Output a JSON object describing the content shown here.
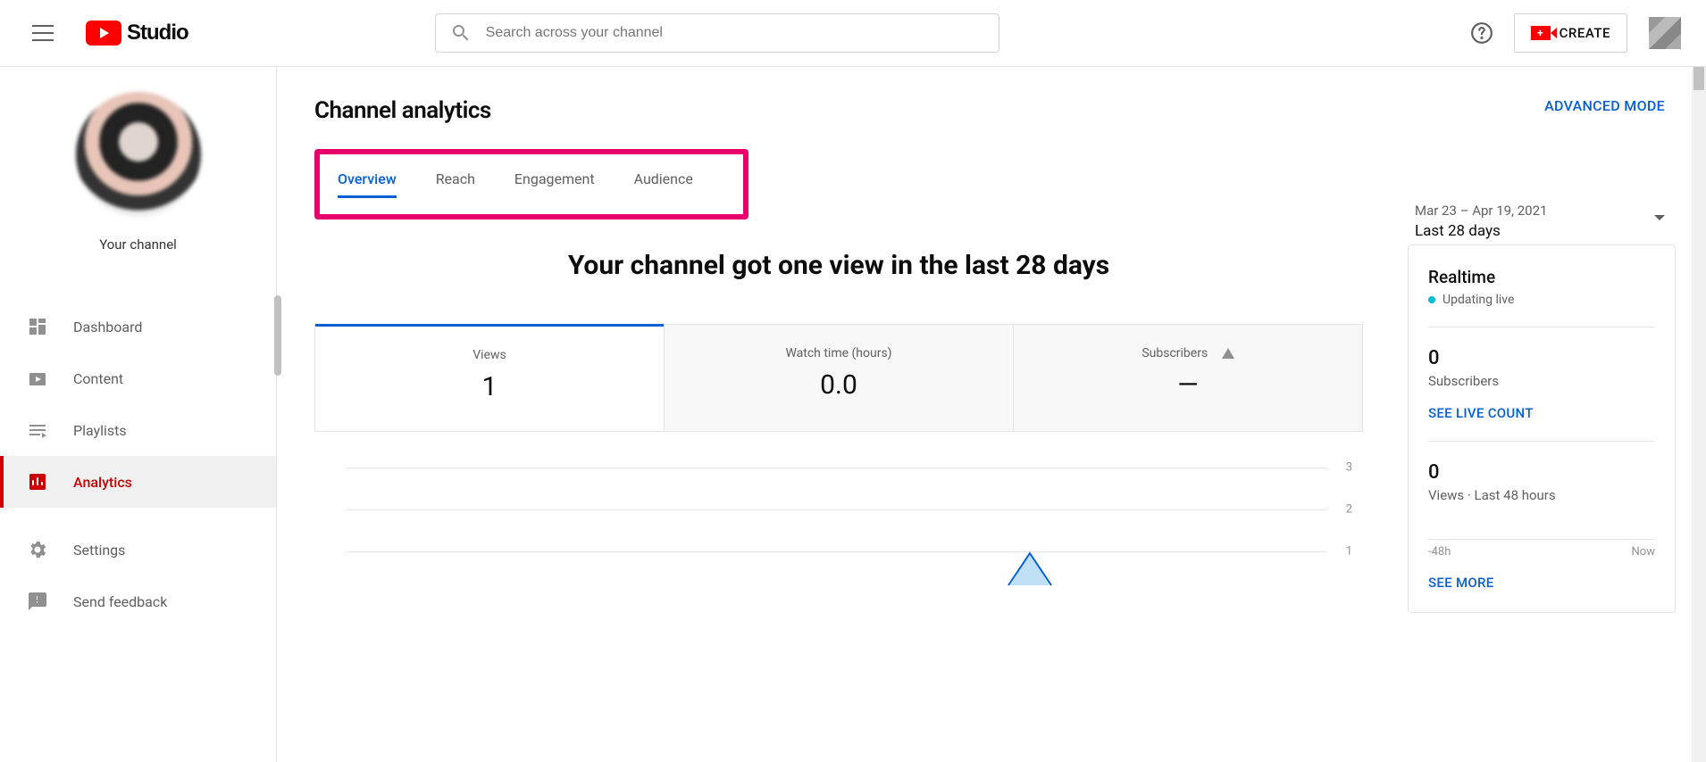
{
  "header": {
    "studio_label": "Studio",
    "search_placeholder": "Search across your channel",
    "create_label": "CREATE"
  },
  "sidebar": {
    "channel_label": "Your channel",
    "items": [
      {
        "label": "Dashboard"
      },
      {
        "label": "Content"
      },
      {
        "label": "Playlists"
      },
      {
        "label": "Analytics"
      },
      {
        "label": "Settings"
      },
      {
        "label": "Send feedback"
      }
    ]
  },
  "page": {
    "title": "Channel analytics",
    "advanced_mode": "ADVANCED MODE",
    "tabs": [
      "Overview",
      "Reach",
      "Engagement",
      "Audience"
    ],
    "active_tab": "Overview",
    "date_range": "Mar 23 – Apr 19, 2021",
    "date_preset": "Last 28 days",
    "headline": "Your channel got one view in the last 28 days"
  },
  "metrics": [
    {
      "name": "Views",
      "value": "1",
      "selected": true
    },
    {
      "name": "Watch time (hours)",
      "value": "0.0"
    },
    {
      "name": "Subscribers",
      "value": "—",
      "warn": true
    }
  ],
  "chart_data": {
    "type": "line",
    "title": "Views",
    "ylim": [
      0,
      3
    ],
    "yticks": [
      1,
      2,
      3
    ],
    "x_range": [
      "Mar 23, 2021",
      "Apr 19, 2021"
    ],
    "series": [
      {
        "name": "Views",
        "peak_value": 1,
        "peak_position_pct": 70
      }
    ]
  },
  "realtime": {
    "title": "Realtime",
    "updating": "Updating live",
    "subs_value": "0",
    "subs_label": "Subscribers",
    "live_count": "SEE LIVE COUNT",
    "views_value": "0",
    "views_label": "Views · Last 48 hours",
    "axis_left": "-48h",
    "axis_right": "Now",
    "see_more": "SEE MORE"
  }
}
